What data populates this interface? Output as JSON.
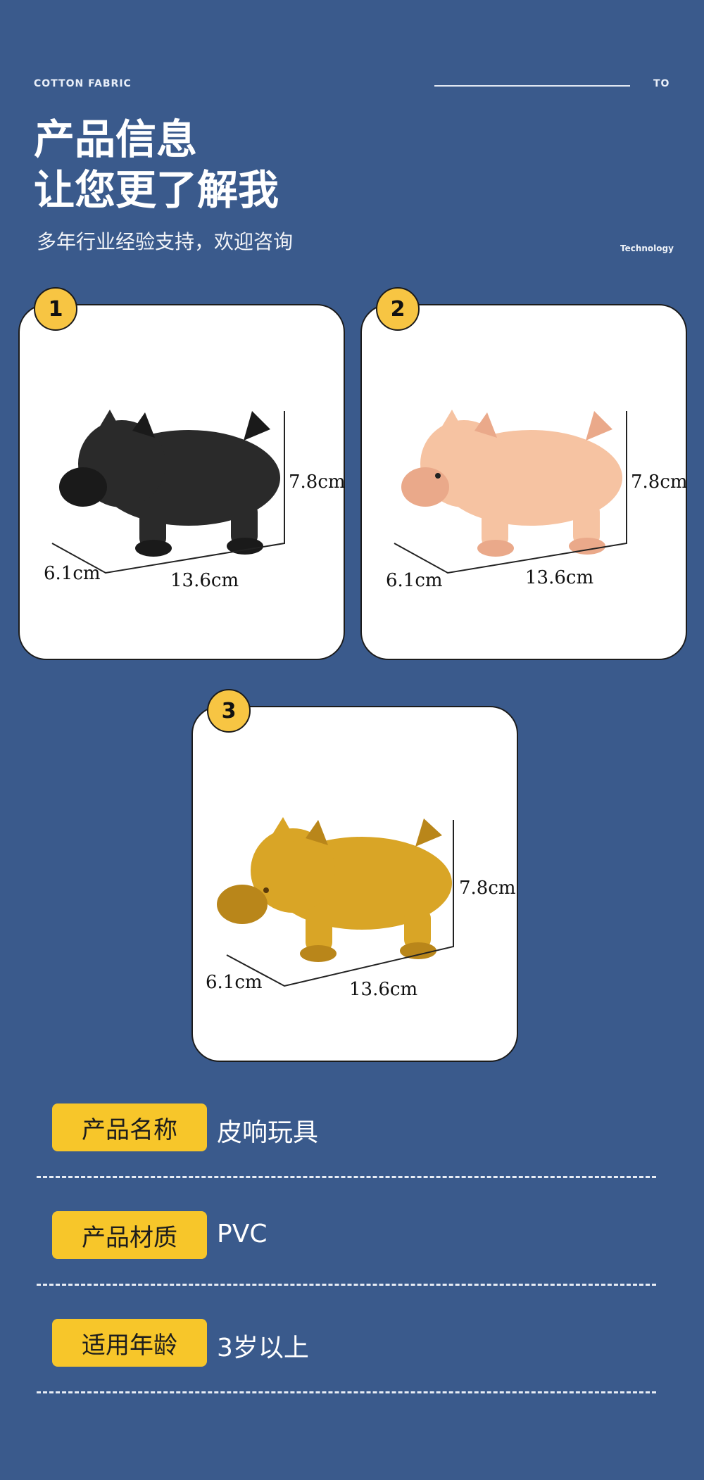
{
  "header": {
    "left_label": "COTTON FABRIC",
    "right_label": "TO",
    "title_line1": "产品信息",
    "title_line2": "让您更了解我",
    "subtitle": "多年行业经验支持，欢迎咨询",
    "tech_label": "Technology"
  },
  "products": [
    {
      "number": "1",
      "color_name": "black",
      "body_color": "#2a2a2a",
      "accent_color": "#1a1a1a",
      "height": "7.8cm",
      "depth": "6.1cm",
      "length": "13.6cm"
    },
    {
      "number": "2",
      "color_name": "pink",
      "body_color": "#f6c3a2",
      "accent_color": "#eaa98a",
      "height": "7.8cm",
      "depth": "6.1cm",
      "length": "13.6cm"
    },
    {
      "number": "3",
      "color_name": "gold",
      "body_color": "#d9a526",
      "accent_color": "#b9861a",
      "height": "7.8cm",
      "depth": "6.1cm",
      "length": "13.6cm"
    }
  ],
  "specs": [
    {
      "label": "产品名称",
      "value": "皮响玩具"
    },
    {
      "label": "产品材质",
      "value": "PVC"
    },
    {
      "label": "适用年龄",
      "value": "3岁以上"
    }
  ],
  "colors": {
    "background": "#3a5a8c",
    "badge": "#f7c543",
    "pill": "#f7c62a"
  }
}
